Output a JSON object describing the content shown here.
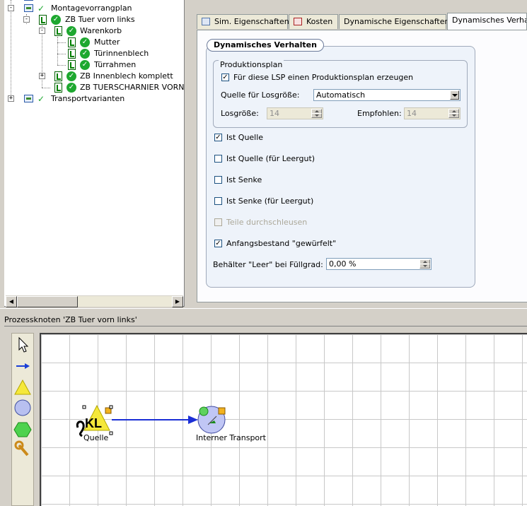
{
  "tree": {
    "items": [
      {
        "label": "Montagevorrangplan"
      },
      {
        "label": "ZB Tuer vorn links"
      },
      {
        "label": "Warenkorb"
      },
      {
        "label": "Mutter"
      },
      {
        "label": "Türinnenblech"
      },
      {
        "label": "Türrahmen"
      },
      {
        "label": "ZB Innenblech komplett"
      },
      {
        "label": "ZB TUERSCHARNIER VORN UN"
      },
      {
        "label": "Transportvarianten"
      }
    ]
  },
  "tabs": [
    {
      "label": "Sim. Eigenschaften"
    },
    {
      "label": "Kosten"
    },
    {
      "label": "Dynamische Eigenschaften"
    },
    {
      "label": "Dynamisches Verhalten"
    }
  ],
  "dyn": {
    "group_title": "Dynamisches Verhalten",
    "production": {
      "title": "Produktionsplan",
      "create_plan_label": "Für diese LSP einen Produktionsplan erzeugen",
      "create_plan_checked": true,
      "source_lot_label": "Quelle für Losgröße:",
      "source_lot_value": "Automatisch",
      "lot_size_label": "Losgröße:",
      "lot_size_value": "14",
      "recommended_label": "Empfohlen:",
      "recommended_value": "14"
    },
    "options": [
      {
        "label": "Ist Quelle",
        "checked": true,
        "disabled": false
      },
      {
        "label": "Ist Quelle (für Leergut)",
        "checked": false,
        "disabled": false
      },
      {
        "label": "Ist Senke",
        "checked": false,
        "disabled": false
      },
      {
        "label": "Ist Senke (für Leergut)",
        "checked": false,
        "disabled": false
      },
      {
        "label": "Teile durchschleusen",
        "checked": false,
        "disabled": true
      },
      {
        "label": "Anfangsbestand \"gewürfelt\"",
        "checked": true,
        "disabled": false
      }
    ],
    "container_label": "Behälter \"Leer\" bei Füllgrad:",
    "container_value": "0,00 %"
  },
  "process": {
    "title": "Prozessknoten 'ZB Tuer vorn links'",
    "nodes": [
      {
        "label": "Quelle"
      },
      {
        "label": "Interner Transport"
      }
    ],
    "palette": [
      "pointer-tool-icon",
      "arrow-tool-icon",
      "triangle-tool-icon",
      "circle-tool-icon",
      "hexagon-tool-icon",
      "wrench-tool-icon"
    ]
  }
}
